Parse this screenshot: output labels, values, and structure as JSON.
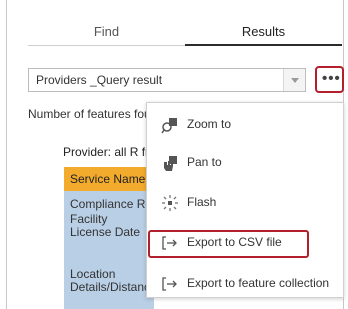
{
  "tabs": {
    "find": "Find",
    "results": "Results"
  },
  "layer_select": {
    "value": "Providers _Query result"
  },
  "more_button": {
    "icon": "more-horizontal-icon",
    "label": "•••"
  },
  "feature_count": {
    "text": "Number of features fou"
  },
  "provider": {
    "text": "Provider: all R frie"
  },
  "card": {
    "header": "Service Name: /",
    "field1": "Compliance Re",
    "field2": "Facility License Date",
    "field3": "Location Details/Distanc"
  },
  "menu": {
    "items": [
      {
        "label": "Zoom to",
        "icon": "zoom-to-icon"
      },
      {
        "label": "Pan to",
        "icon": "pan-to-icon"
      },
      {
        "label": "Flash",
        "icon": "flash-icon"
      },
      {
        "label": "Export to CSV file",
        "icon": "export-icon"
      },
      {
        "label": "Export to feature collection",
        "icon": "export-icon"
      }
    ]
  },
  "colors": {
    "highlight": "#b21f2d",
    "card_header": "#f2ab2d",
    "card_body": "#b9cfe6"
  }
}
